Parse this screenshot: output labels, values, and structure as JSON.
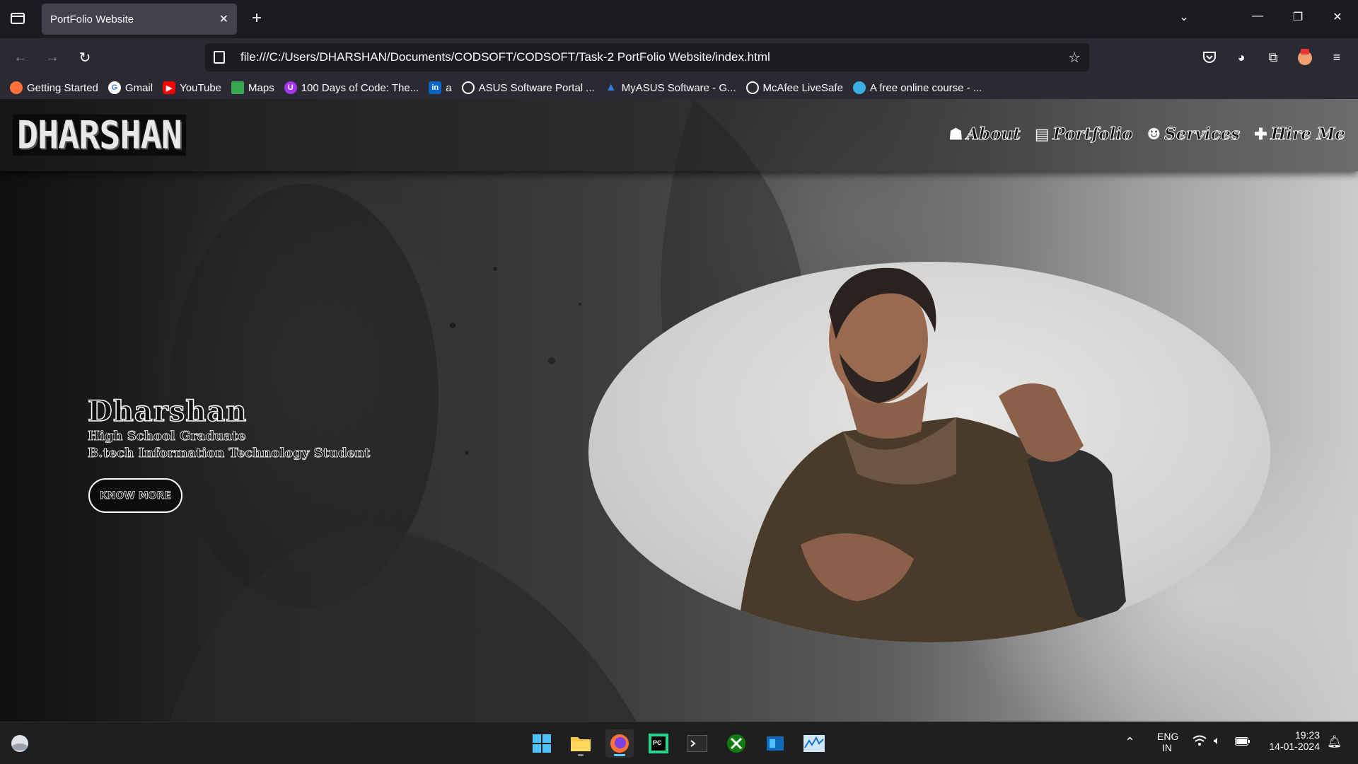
{
  "browser": {
    "tab_title": "PortFolio Website",
    "url": "file:///C:/Users/DHARSHAN/Documents/CODSOFT/CODSOFT/Task-2 PortFolio Website/index.html",
    "bookmarks": [
      {
        "label": "Getting Started",
        "icon": "firefox-icon",
        "color": "#ff7139"
      },
      {
        "label": "Gmail",
        "icon": "google-icon",
        "color": "#4285f4"
      },
      {
        "label": "YouTube",
        "icon": "youtube-icon",
        "color": "#ff0000"
      },
      {
        "label": "Maps",
        "icon": "maps-icon",
        "color": "#34a853"
      },
      {
        "label": "100 Days of Code: The...",
        "icon": "udemy-icon",
        "color": "#a435f0"
      },
      {
        "label": "a",
        "icon": "linkedin-icon",
        "color": "#0a66c2"
      },
      {
        "label": "ASUS Software Portal ...",
        "icon": "globe-icon",
        "color": "#6b6b6b"
      },
      {
        "label": "MyASUS Software - G...",
        "icon": "myasus-icon",
        "color": "#2f7de1"
      },
      {
        "label": "McAfee LiveSafe",
        "icon": "globe-icon",
        "color": "#6b6b6b"
      },
      {
        "label": "A free online course - ...",
        "icon": "course-icon",
        "color": "#3ab0e2"
      }
    ]
  },
  "site": {
    "logo": "DHARSHAN",
    "nav": [
      {
        "label": "About",
        "icon": "person-icon",
        "glyph": "☗"
      },
      {
        "label": "Portfolio",
        "icon": "id-card-icon",
        "glyph": "▤"
      },
      {
        "label": "Services",
        "icon": "users-icon",
        "glyph": "☻"
      },
      {
        "label": "Hire Me",
        "icon": "user-plus-icon",
        "glyph": "✚"
      }
    ],
    "hero": {
      "name": "Dharshan",
      "line1": "High School Graduate",
      "line2": "B.tech Information Technology Student",
      "button": "KNOW MORE"
    }
  },
  "taskbar": {
    "language": "ENG",
    "region": "IN",
    "time": "19:23",
    "date": "14-01-2024"
  }
}
